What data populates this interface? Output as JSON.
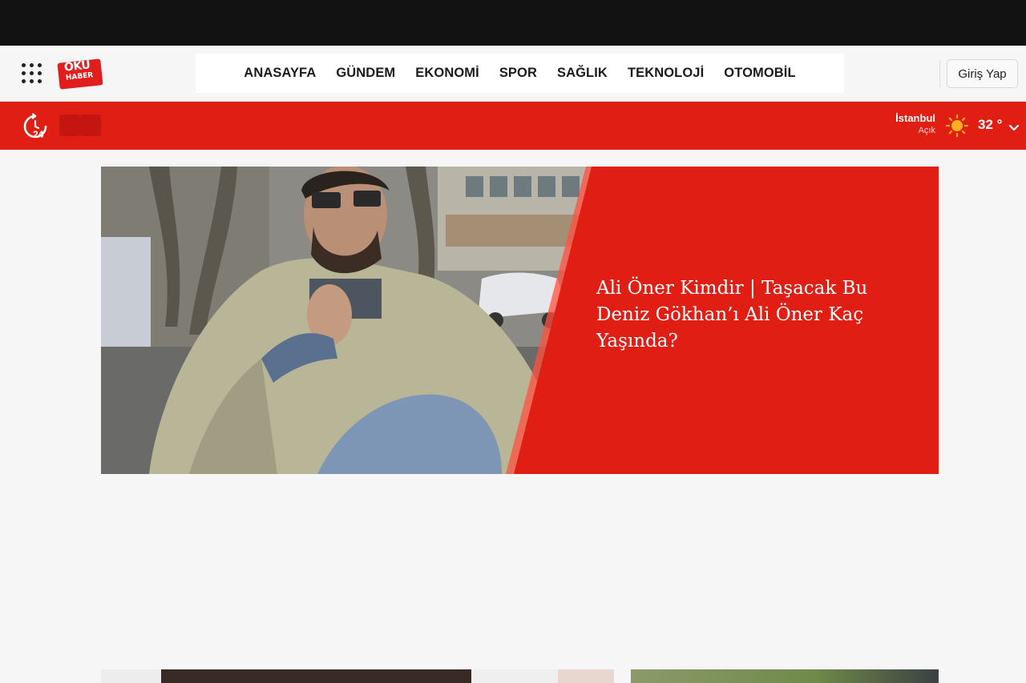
{
  "header": {
    "logo_top": "OKU",
    "logo_bottom": "HABER",
    "login_label": "Giriş Yap"
  },
  "nav": {
    "items": [
      {
        "label": "ANASAYFA"
      },
      {
        "label": "GÜNDEM"
      },
      {
        "label": "EKONOMİ"
      },
      {
        "label": "SPOR"
      },
      {
        "label": "SAĞLIK"
      },
      {
        "label": "TEKNOLOJİ"
      },
      {
        "label": "OTOMOBİL"
      }
    ]
  },
  "weather": {
    "city": "İstanbul",
    "condition": "Açık",
    "temperature": "32 °",
    "icon": "sun-icon"
  },
  "breaking": {
    "icon": "news-24-icon",
    "badge_text": "24"
  },
  "hero": {
    "title": "Ali Öner Kimdir | Taşacak Bu Deniz Gökhan’ı Ali Öner Kaç Yaşında?"
  },
  "colors": {
    "brand_red": "#e01e14",
    "top_bar": "#121212",
    "background": "#f6f6f6"
  }
}
